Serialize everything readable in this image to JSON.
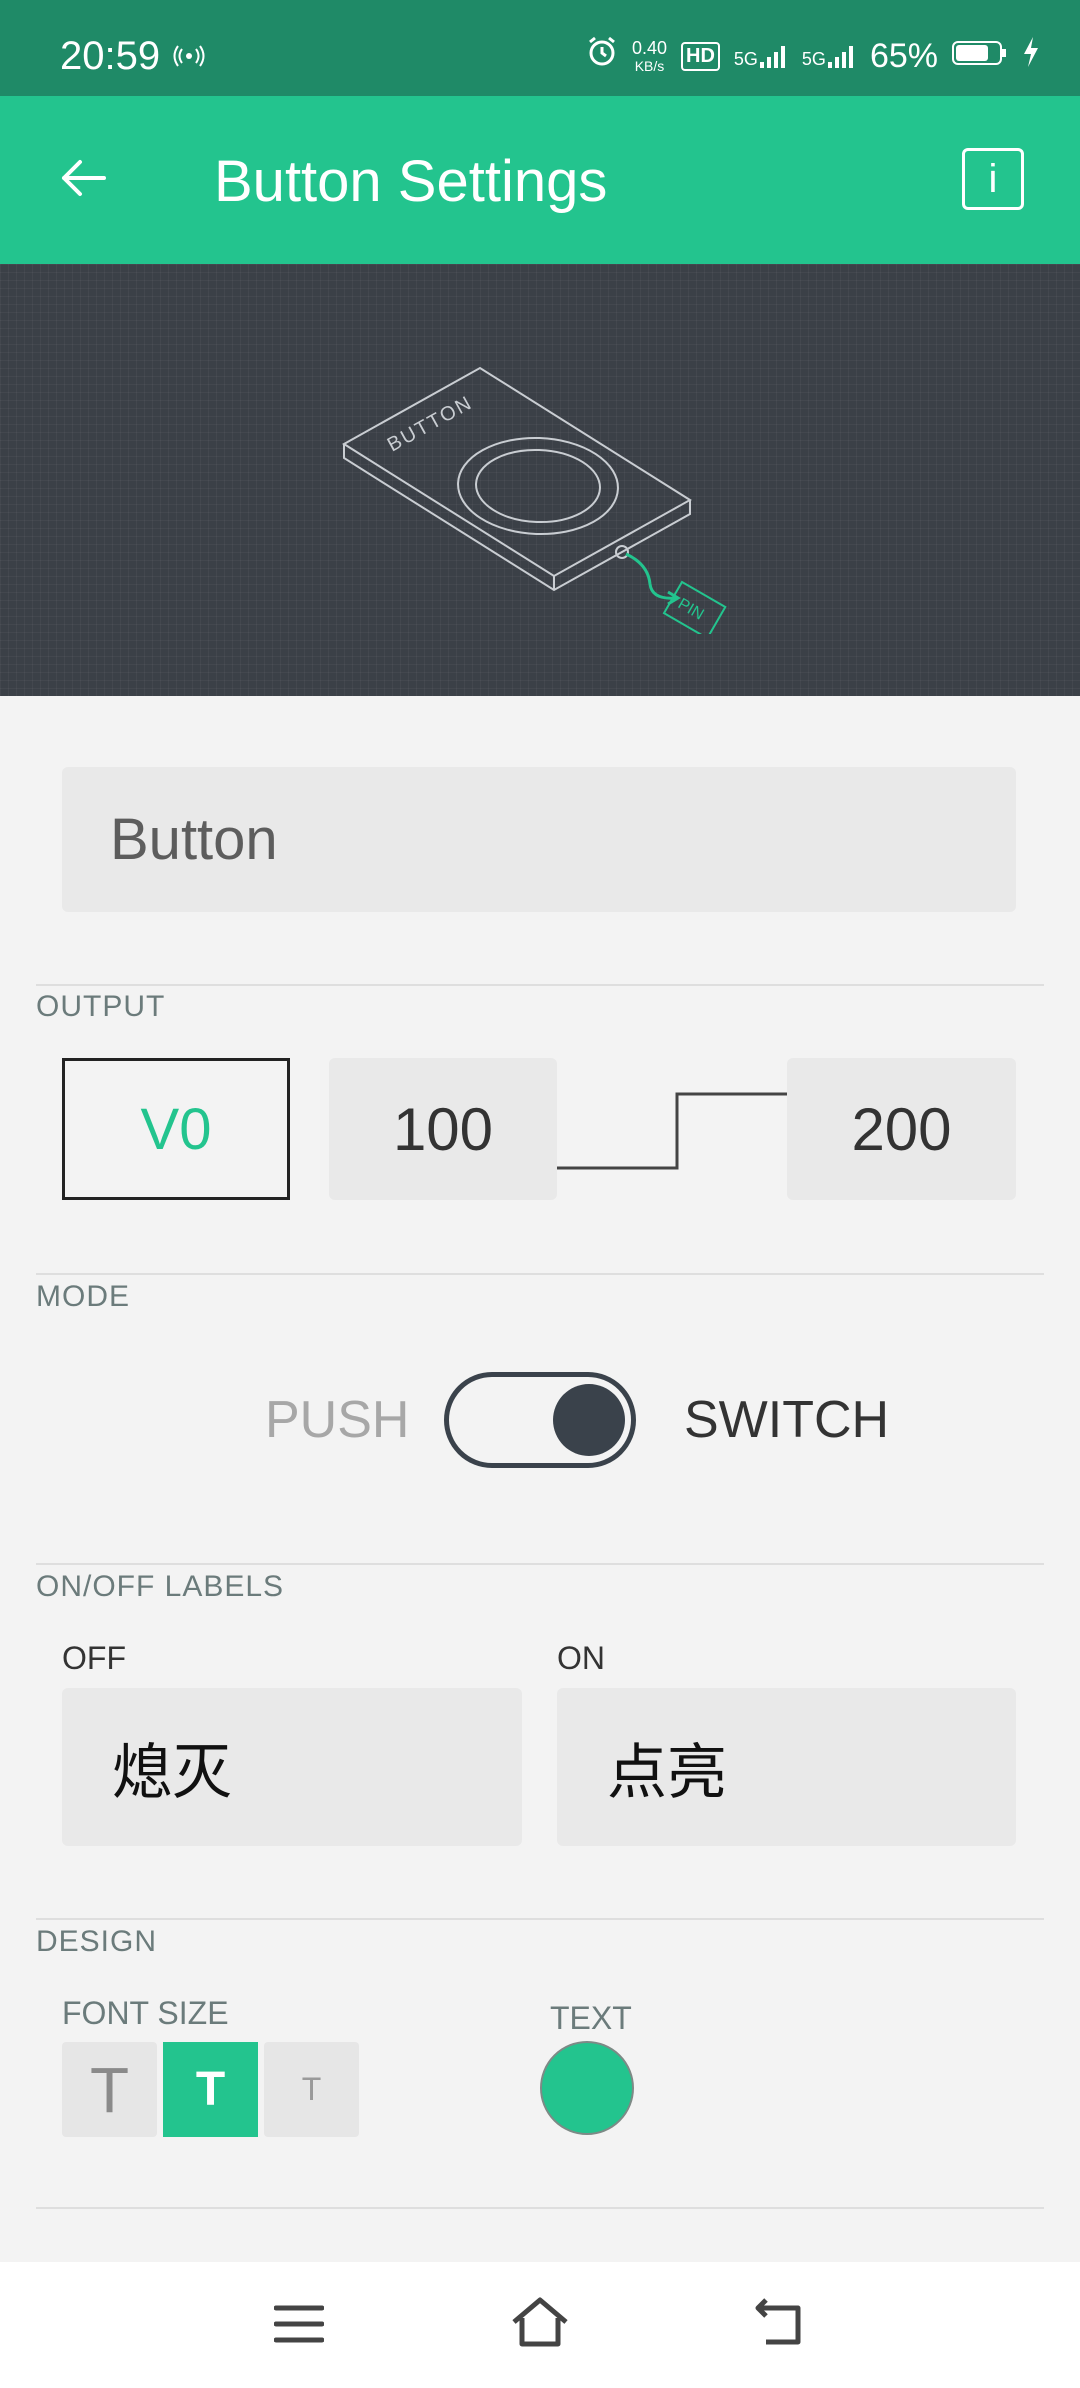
{
  "status_bar": {
    "time": "20:59",
    "net_speed_value": "0.40",
    "net_speed_unit": "KB/s",
    "network_1": "5G",
    "network_2": "5G",
    "battery": "65%"
  },
  "app_bar": {
    "title": "Button Settings",
    "info_label": "i"
  },
  "hero": {
    "device_label": "BUTTON",
    "pin_label": "PIN"
  },
  "name_field": {
    "value": "Button"
  },
  "output": {
    "label": "OUTPUT",
    "pin": "V0",
    "min": "100",
    "max": "200"
  },
  "mode": {
    "label": "MODE",
    "push": "PUSH",
    "switch": "SWITCH",
    "selected": "SWITCH"
  },
  "labels": {
    "label": "ON/OFF LABELS",
    "off_label": "OFF",
    "off_value": "熄灭",
    "on_label": "ON",
    "on_value": "点亮"
  },
  "design": {
    "label": "DESIGN",
    "font_size_label": "FONT SIZE",
    "font_options": [
      "T",
      "T",
      "T"
    ],
    "font_selected_index": 1,
    "text_color_label": "TEXT",
    "text_color": "#23c48e"
  },
  "colors": {
    "accent": "#23c48e",
    "status_bar": "#1f8a67",
    "hero_bg": "#3b4047"
  }
}
